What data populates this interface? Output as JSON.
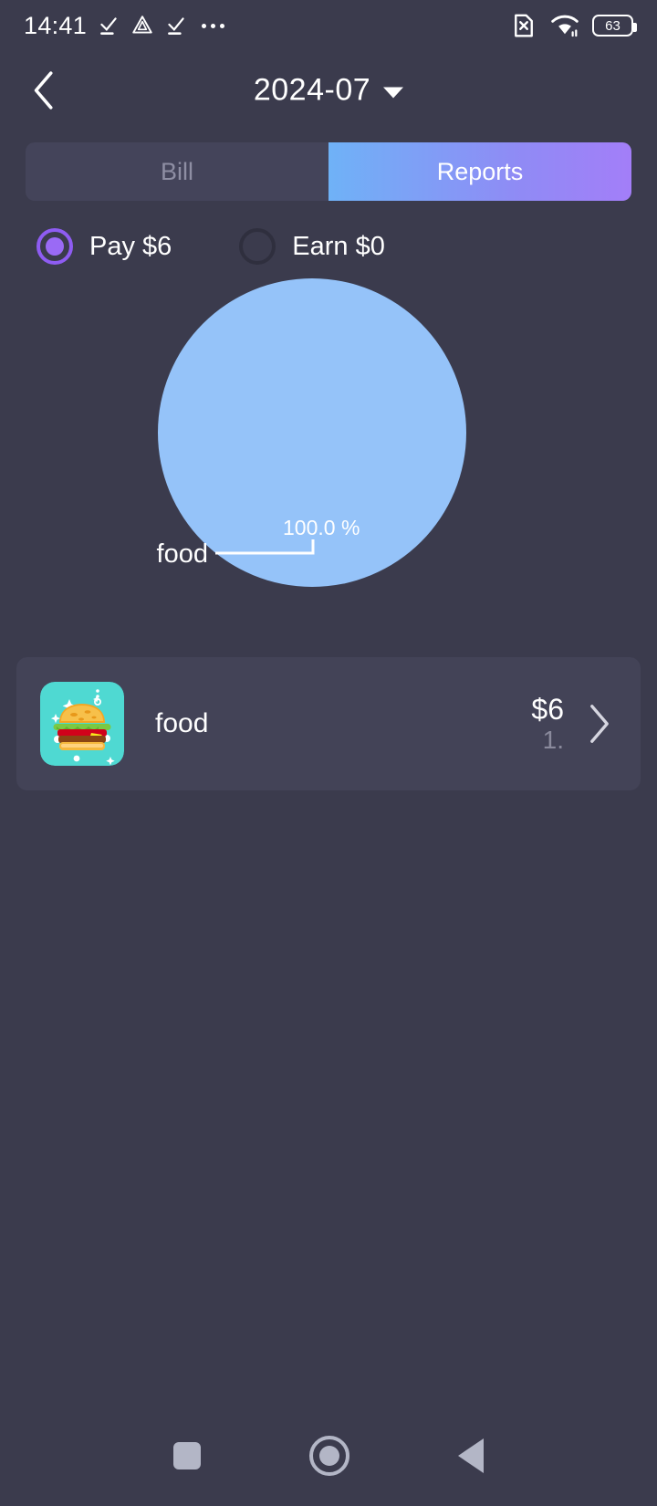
{
  "status_bar": {
    "time": "14:41",
    "battery_level": "63",
    "icons": [
      "check-download-icon",
      "triangle-cloud-icon",
      "check-download-icon",
      "more-dots-icon",
      "sim-x-icon",
      "wifi-icon",
      "battery-icon"
    ]
  },
  "app_bar": {
    "back_label": "back",
    "title": "2024-07",
    "caret": "chevron-down-icon"
  },
  "tabs": [
    {
      "label": "Bill",
      "active": false
    },
    {
      "label": "Reports",
      "active": true
    }
  ],
  "filters": [
    {
      "label": "Pay $6",
      "selected": true
    },
    {
      "label": "Earn $0",
      "selected": false
    }
  ],
  "chart_data": {
    "type": "pie",
    "title": "",
    "categories": [
      "food"
    ],
    "values": [
      6
    ],
    "percent_labels": [
      "100.0 %"
    ],
    "colors": [
      "#95c3f9"
    ],
    "labels": [
      "food"
    ],
    "legend_position": "callout",
    "grid": false
  },
  "list": {
    "items": [
      {
        "icon": "burger-food-icon",
        "name": "food",
        "amount": "$6",
        "sub": "1.",
        "chevron": "chevron-right-icon"
      }
    ]
  },
  "nav_bar": {
    "recents": "square-icon",
    "home": "circle-icon",
    "back": "triangle-back-icon"
  },
  "colors": {
    "background": "#3b3b4d",
    "card": "#434357",
    "tab_active_start": "#6fb2f7",
    "tab_active_end": "#a37ef8",
    "accent": "#9a6af5",
    "pie_slice": "#95c3f9"
  }
}
